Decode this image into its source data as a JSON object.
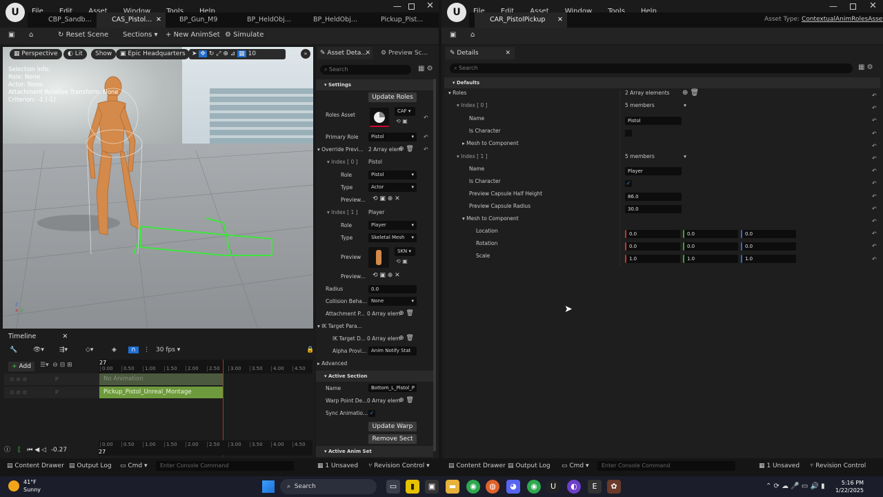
{
  "left_window": {
    "menu": [
      "File",
      "Edit",
      "Asset",
      "Window",
      "Tools",
      "Help"
    ],
    "tabs": [
      "CBP_Sandb...",
      "CAS_Pistol...",
      "BP_Gun_M9",
      "BP_HeldObj...",
      "BP_HeldObj...",
      "Pickup_Pist..."
    ],
    "toolbar": {
      "reset": "Reset Scene",
      "sections": "Sections",
      "new_animset": "New AnimSet",
      "simulate": "Simulate"
    },
    "viewport": {
      "perspective": "Perspective",
      "lit": "Lit",
      "show": "Show",
      "location": "Epic Headquarters",
      "snap_value": "10",
      "info": [
        "Selection Info:",
        "Role: None",
        "Actor: None",
        "Attachment Relative Transform: None",
        "Criterion: -1 (-1)"
      ]
    },
    "timeline": {
      "title": "Timeline",
      "add": "Add",
      "fps": "30 fps",
      "frame": "27",
      "ticks": [
        "0.00",
        "0.50",
        "1.00",
        "1.50",
        "2.00",
        "2.50",
        "3.00",
        "3.50",
        "4.00",
        "4.50"
      ],
      "tracks": [
        "No Animation",
        "Pickup_Pistol_Unreal_Montage"
      ],
      "current_time": "-0.27",
      "bottom_frame": "27"
    },
    "asset_details": {
      "tab1": "Asset Deta...",
      "tab2": "Preview Sc...",
      "search_placeholder": "Search",
      "settings": "Settings",
      "update_roles": "Update Roles",
      "roles_asset": "Roles Asset",
      "roles_asset_value": "CAF",
      "primary_role": "Primary Role",
      "primary_role_value": "Pistol",
      "override_preview": "Override Previ...",
      "array_elem": "2 Array elem",
      "index0": "Index [ 0 ]",
      "index0_value": "Pistol",
      "role": "Role",
      "role0_value": "Pistol",
      "type": "Type",
      "type0_value": "Actor",
      "preview": "Preview...",
      "index1": "Index [ 1 ]",
      "index1_value": "Player",
      "role1_value": "Player",
      "type1_value": "Skeletal Mesh",
      "preview_label": "Preview",
      "preview_dropdown": "SKN",
      "preview2": "Preview...",
      "radius": "Radius",
      "radius_value": "0.0",
      "collision": "Collision Beha...",
      "collision_value": "None",
      "attachment": "Attachment P...",
      "zero_array": "0 Array elem",
      "ik_target": "IK Target Para...",
      "ik_target_d": "IK Target D...",
      "ik_zero_array": "0 Array elem",
      "alpha": "Alpha Provi...",
      "alpha_value": "Anim Notify Stat",
      "advanced": "Advanced",
      "active_section": "Active Section",
      "name": "Name",
      "name_value": "Bottom_L_Pistol_P",
      "warp_point": "Warp Point De...",
      "warp_zero_array": "0 Array elem",
      "sync_animation": "Sync Animatio...",
      "update_warp": "Update Warp",
      "remove_sect": "Remove Sect",
      "active_anim_set": "Active Anim Set"
    },
    "statusbar": {
      "content": "Content Drawer",
      "output": "Output Log",
      "cmd": "Cmd",
      "console": "Enter Console Command",
      "unsaved": "1 Unsaved",
      "revision": "Revision Control"
    }
  },
  "right_window": {
    "menu": [
      "File",
      "Edit",
      "Asset",
      "Window",
      "Tools",
      "Help"
    ],
    "tab": "CAR_PistolPickup",
    "asset_type_label": "Asset Type:",
    "asset_type_value": "ContextualAnimRolesAsset",
    "details": "Details",
    "search_placeholder": "Search",
    "defaults": "Defaults",
    "roles": "Roles",
    "roles_value": "2 Array elements",
    "index0": "Index [ 0 ]",
    "members": "5 members",
    "name": "Name",
    "name0_value": "Pistol",
    "is_character": "Is Character",
    "mesh_to_component": "Mesh to Component",
    "index1": "Index [ 1 ]",
    "members1": "5 members",
    "name1_value": "Player",
    "is_character1": "Is Character",
    "capsule_half": "Preview Capsule Half Height",
    "capsule_half_value": "86.0",
    "capsule_radius": "Preview Capsule Radius",
    "capsule_radius_value": "30.0",
    "mesh_to_component1": "Mesh to Component",
    "location": "Location",
    "rotation": "Rotation",
    "scale": "Scale",
    "loc_vals": [
      "0.0",
      "0.0",
      "0.0"
    ],
    "rot_vals": [
      "0.0",
      "0.0",
      "0.0"
    ],
    "scale_vals": [
      "1.0",
      "1.0",
      "1.0"
    ],
    "statusbar": {
      "content": "Content Drawer",
      "output": "Output Log",
      "cmd": "Cmd",
      "console": "Enter Console Command",
      "unsaved": "1 Unsaved",
      "revision": "Revision Control"
    }
  },
  "taskbar": {
    "temp": "41°F",
    "weather": "Sunny",
    "search": "Search",
    "time": "5:16 PM",
    "date": "1/22/2025"
  },
  "colors": {
    "accent_blue": "#1f6fd1",
    "timeline_green": "#6d9a3c",
    "guide_green": "#3ee63e",
    "mannequin": "#d48a4a"
  }
}
